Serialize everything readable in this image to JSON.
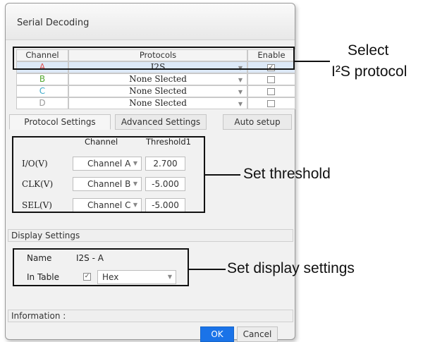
{
  "window": {
    "title": "Serial Decoding"
  },
  "protocol_table": {
    "headers": {
      "channel": "Channel",
      "protocols": "Protocols",
      "enable": "Enable"
    },
    "rows": [
      {
        "channel": "A",
        "channel_color": "#e05050",
        "protocol": "I2S",
        "enabled": "✓"
      },
      {
        "channel": "B",
        "channel_color": "#55a832",
        "protocol": "None Slected",
        "enabled": ""
      },
      {
        "channel": "C",
        "channel_color": "#3aa8c8",
        "protocol": "None Slected",
        "enabled": ""
      },
      {
        "channel": "D",
        "channel_color": "#9a9a9a",
        "protocol": "None Slected",
        "enabled": ""
      }
    ]
  },
  "tabs": [
    "Protocol Settings",
    "Advanced Settings",
    "Auto setup"
  ],
  "protocol_settings": {
    "col_channel": "Channel",
    "col_threshold": "Threshold1",
    "rows": [
      {
        "label": "I/O(V)",
        "channel": "Channel A",
        "threshold": "2.700"
      },
      {
        "label": "CLK(V)",
        "channel": "Channel B",
        "threshold": "-5.000"
      },
      {
        "label": "SEL(V)",
        "channel": "Channel C",
        "threshold": "-5.000"
      }
    ]
  },
  "display_settings": {
    "header": "Display Settings",
    "name_label": "Name",
    "name_value": "I2S - A",
    "in_table_label": "In Table",
    "in_table_checked": "✓",
    "format": "Hex"
  },
  "information": {
    "label": "Information :"
  },
  "buttons": {
    "ok": "OK",
    "cancel": "Cancel"
  },
  "annotations": {
    "select_line1": "Select",
    "select_line2": "I²S protocol",
    "threshold": "Set threshold",
    "display": "Set display settings"
  },
  "colors": {
    "ok_button": "#1a73e8",
    "selected_row": "#dde9f7"
  }
}
